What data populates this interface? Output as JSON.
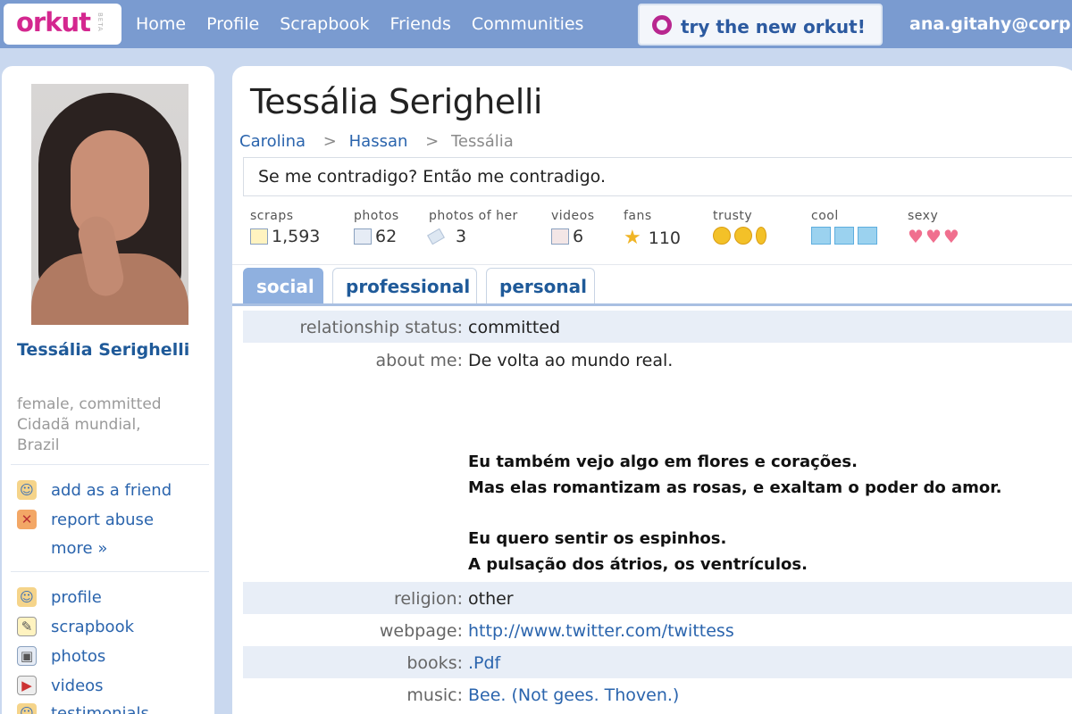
{
  "topbar": {
    "logo": "orkut",
    "logo_sub": "BETA",
    "nav": [
      "Home",
      "Profile",
      "Scrapbook",
      "Friends",
      "Communities"
    ],
    "try_label": "try the new orkut!",
    "user": "ana.gitahy@corp"
  },
  "sidebar": {
    "name": "Tessália Serighelli",
    "info_line1": "female, committed",
    "info_line2": "Cidadã mundial,",
    "info_line3": "Brazil",
    "actions": {
      "add_friend": "add as a friend",
      "report": "report abuse",
      "more": "more »"
    },
    "links": {
      "profile": "profile",
      "scrapbook": "scrapbook",
      "photos": "photos",
      "videos": "videos",
      "testimonials": "testimonials"
    }
  },
  "main": {
    "title": "Tessália Serighelli",
    "breadcrumb": [
      "Carolina",
      "Hassan",
      "Tessália"
    ],
    "breadcrumb_sep": ">",
    "status": "Se me contradigo? Então me contradigo.",
    "stats": {
      "scraps_label": "scraps",
      "scraps_value": "1,593",
      "photos_label": "photos",
      "photos_value": "62",
      "photos_of_her_label": "photos of her",
      "photos_of_her_value": "3",
      "videos_label": "videos",
      "videos_value": "6",
      "fans_label": "fans",
      "fans_value": "110",
      "trusty_label": "trusty",
      "cool_label": "cool",
      "sexy_label": "sexy"
    },
    "tabs": [
      "social",
      "professional",
      "personal"
    ],
    "fields": {
      "relationship_label": "relationship status:",
      "relationship_value": "committed",
      "about_label": "about me:",
      "about_line1": "De volta ao mundo real.",
      "about_p1a": "Eu também vejo algo em flores e corações.",
      "about_p1b": "Mas elas romantizam as rosas, e exaltam o poder do amor.",
      "about_p2a": "Eu quero sentir os espinhos.",
      "about_p2b": "A pulsação dos átrios, os ventrículos.",
      "religion_label": "religion:",
      "religion_value": "other",
      "webpage_label": "webpage:",
      "webpage_value": "http://www.twitter.com/twittess",
      "books_label": "books:",
      "books_value": ".Pdf",
      "music_label": "music:",
      "music_value": "Bee. (Not gees. Thoven.)"
    }
  },
  "colors": {
    "brand": "#d4278f",
    "nav_bg": "#7a9bd0",
    "link": "#2a64ad",
    "tab_active": "#8fb0df"
  }
}
